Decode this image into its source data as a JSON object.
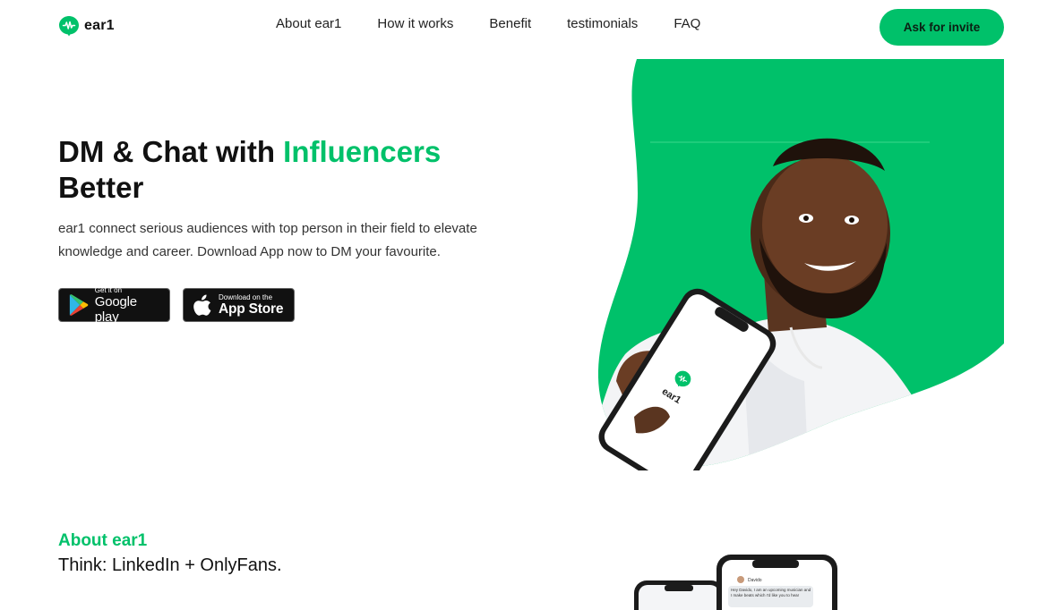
{
  "brand": {
    "name": "ear1",
    "accent_color": "#00c16a"
  },
  "nav": {
    "items": [
      {
        "label": "About ear1"
      },
      {
        "label": "How it works"
      },
      {
        "label": "Benefit"
      },
      {
        "label": "testimonials"
      },
      {
        "label": "FAQ"
      }
    ],
    "cta_label": "Ask for invite"
  },
  "hero": {
    "title_part1": "DM & Chat with ",
    "title_accent": "Influencers",
    "title_part2": "Better",
    "description": "ear1 connect serious audiences with top person in their field to elevate knowledge and career. Download App now to DM your favourite.",
    "google_play": {
      "small": "Get it on",
      "big": "Google play",
      "icon": "google-play-icon"
    },
    "app_store": {
      "small": "Download on the",
      "big": "App Store",
      "icon": "apple-icon"
    },
    "phone_brand": "ear1"
  },
  "about": {
    "heading": "About ear1",
    "tagline": "Think: LinkedIn + OnlyFans.",
    "chat_preview": {
      "contact": "Davido",
      "message": "Hey Davido, I am an upcoming musician and I make beats which I'd like you to hear"
    }
  }
}
